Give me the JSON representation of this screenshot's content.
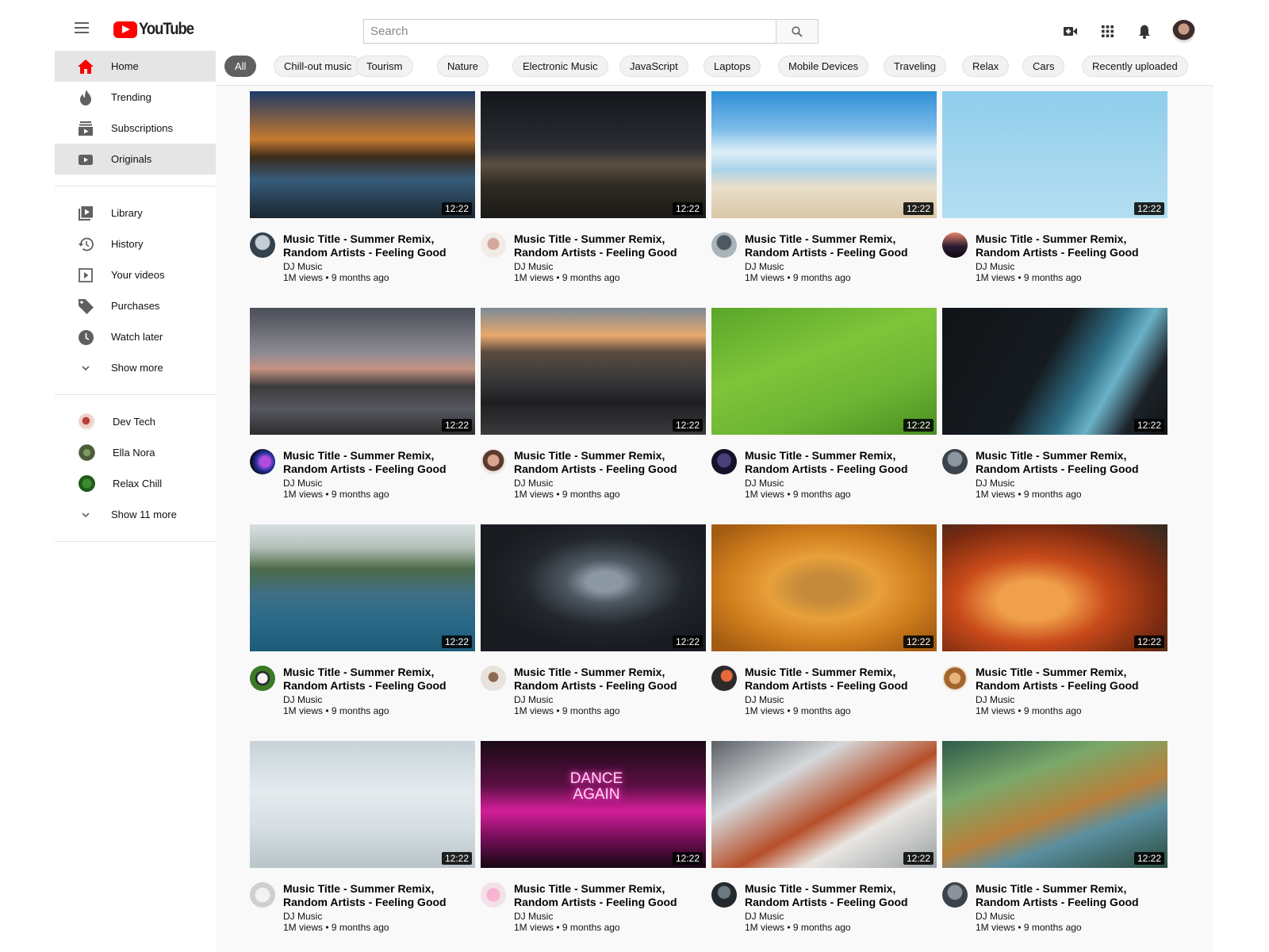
{
  "header": {
    "logo_text": "YouTube",
    "search_placeholder": "Search"
  },
  "sidebar": {
    "main": [
      {
        "label": "Home",
        "icon": "home-icon"
      },
      {
        "label": "Trending",
        "icon": "fire-icon"
      },
      {
        "label": "Subscriptions",
        "icon": "subscriptions-icon"
      },
      {
        "label": "Originals",
        "icon": "play-box-icon"
      }
    ],
    "library": [
      {
        "label": "Library",
        "icon": "library-icon"
      },
      {
        "label": "History",
        "icon": "history-icon"
      },
      {
        "label": "Your videos",
        "icon": "your-videos-icon"
      },
      {
        "label": "Purchases",
        "icon": "tag-icon"
      },
      {
        "label": "Watch later",
        "icon": "clock-icon"
      },
      {
        "label": "Show more",
        "icon": "chevron-down-icon"
      }
    ],
    "subscriptions": [
      {
        "label": "Dev Tech"
      },
      {
        "label": "Ella Nora"
      },
      {
        "label": "Relax Chill"
      },
      {
        "label": "Show 11 more"
      }
    ]
  },
  "chips": [
    "All",
    "Chill-out music",
    "Tourism",
    "Nature",
    "Electronic Music",
    "JavaScript",
    "Laptops",
    "Mobile Devices",
    "Traveling",
    "Relax",
    "Cars",
    "Recently uploaded"
  ],
  "videos": [
    {
      "title": "Music Title - Summer Remix, Random Artists - Feeling Good",
      "channel": "DJ Music",
      "meta": "1M views • 9 months ago",
      "duration": "12:22"
    },
    {
      "title": "Music Title - Summer Remix, Random Artists - Feeling Good",
      "channel": "DJ Music",
      "meta": "1M views • 9 months ago",
      "duration": "12:22"
    },
    {
      "title": "Music Title - Summer Remix, Random Artists - Feeling Good",
      "channel": "DJ Music",
      "meta": "1M views • 9 months ago",
      "duration": "12:22"
    },
    {
      "title": "Music Title - Summer Remix, Random Artists - Feeling Good",
      "channel": "DJ Music",
      "meta": "1M views • 9 months ago",
      "duration": "12:22"
    },
    {
      "title": "Music Title - Summer Remix, Random Artists - Feeling Good",
      "channel": "DJ Music",
      "meta": "1M views • 9 months ago",
      "duration": "12:22"
    },
    {
      "title": "Music Title - Summer Remix, Random Artists - Feeling Good",
      "channel": "DJ Music",
      "meta": "1M views • 9 months ago",
      "duration": "12:22"
    },
    {
      "title": "Music Title - Summer Remix, Random Artists - Feeling Good",
      "channel": "DJ Music",
      "meta": "1M views • 9 months ago",
      "duration": "12:22"
    },
    {
      "title": "Music Title - Summer Remix, Random Artists - Feeling Good",
      "channel": "DJ Music",
      "meta": "1M views • 9 months ago",
      "duration": "12:22"
    },
    {
      "title": "Music Title - Summer Remix, Random Artists - Feeling Good",
      "channel": "DJ Music",
      "meta": "1M views • 9 months ago",
      "duration": "12:22"
    },
    {
      "title": "Music Title - Summer Remix, Random Artists - Feeling Good",
      "channel": "DJ Music",
      "meta": "1M views • 9 months ago",
      "duration": "12:22"
    },
    {
      "title": "Music Title - Summer Remix, Random Artists - Feeling Good",
      "channel": "DJ Music",
      "meta": "1M views • 9 months ago",
      "duration": "12:22"
    },
    {
      "title": "Music Title - Summer Remix, Random Artists - Feeling Good",
      "channel": "DJ Music",
      "meta": "1M views • 9 months ago",
      "duration": "12:22"
    },
    {
      "title": "Music Title - Summer Remix, Random Artists - Feeling Good",
      "channel": "DJ Music",
      "meta": "1M views • 9 months ago",
      "duration": "12:22"
    },
    {
      "title": "Music Title - Summer Remix, Random Artists - Feeling Good",
      "channel": "DJ Music",
      "meta": "1M views • 9 months ago",
      "duration": "12:22",
      "thumb_text": "DANCE AGAIN"
    },
    {
      "title": "Music Title - Summer Remix, Random Artists - Feeling Good",
      "channel": "DJ Music",
      "meta": "1M views • 9 months ago",
      "duration": "12:22"
    },
    {
      "title": "Music Title - Summer Remix, Random Artists - Feeling Good",
      "channel": "DJ Music",
      "meta": "1M views • 9 months ago",
      "duration": "12:22"
    }
  ],
  "colors": {
    "brand": "#ff0000",
    "active_chip": "#606060"
  }
}
